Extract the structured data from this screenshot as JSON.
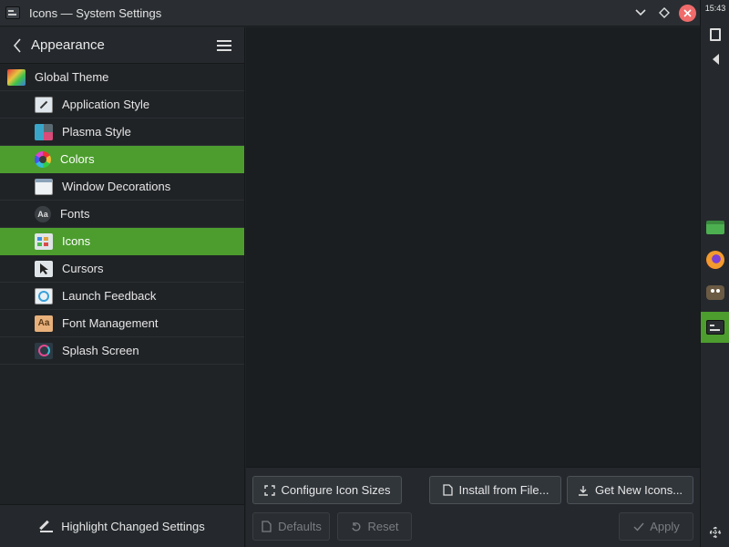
{
  "window": {
    "title": "Icons — System Settings"
  },
  "sidebar": {
    "header_title": "Appearance",
    "items": [
      {
        "label": "Global Theme",
        "icon": "global-theme-icon"
      },
      {
        "label": "Application Style",
        "icon": "application-style-icon"
      },
      {
        "label": "Plasma Style",
        "icon": "plasma-style-icon"
      },
      {
        "label": "Colors",
        "icon": "colors-icon"
      },
      {
        "label": "Window Decorations",
        "icon": "window-decorations-icon"
      },
      {
        "label": "Fonts",
        "icon": "fonts-icon",
        "glyph": "Aa"
      },
      {
        "label": "Icons",
        "icon": "icons-icon"
      },
      {
        "label": "Cursors",
        "icon": "cursors-icon"
      },
      {
        "label": "Launch Feedback",
        "icon": "launch-feedback-icon"
      },
      {
        "label": "Font Management",
        "icon": "font-management-icon",
        "glyph": "Aa"
      },
      {
        "label": "Splash Screen",
        "icon": "splash-screen-icon"
      }
    ],
    "footer_label": "Highlight Changed Settings"
  },
  "footer": {
    "configure_sizes": "Configure Icon Sizes",
    "install_from_file": "Install from File...",
    "get_new_icons": "Get New Icons...",
    "defaults": "Defaults",
    "reset": "Reset",
    "apply": "Apply"
  },
  "panel": {
    "clock": "15:43"
  },
  "colors": {
    "accent": "#4c9d2e",
    "close": "#f06b6b",
    "background": "#202326"
  }
}
